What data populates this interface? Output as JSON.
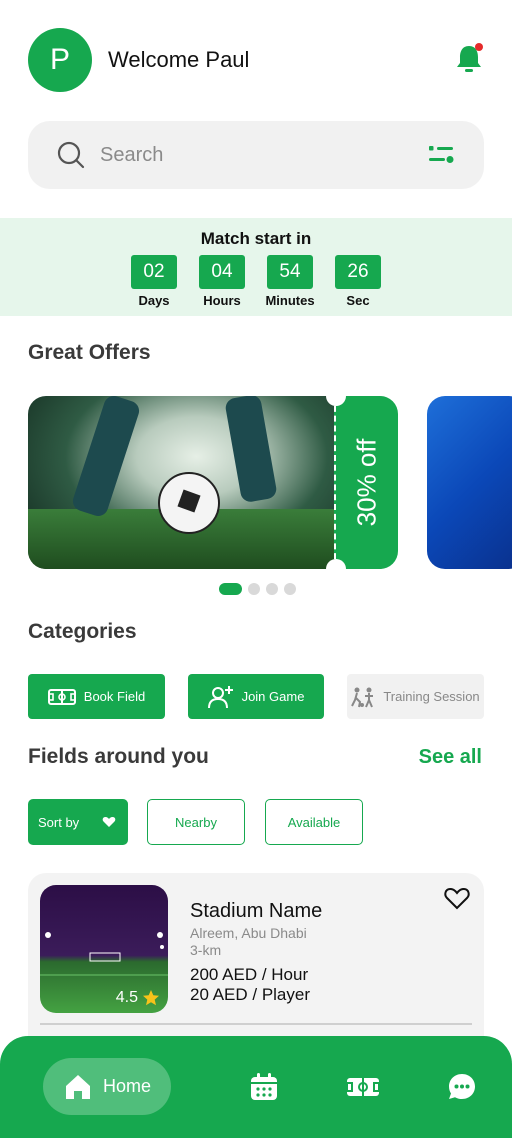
{
  "header": {
    "avatar_initial": "P",
    "welcome_text": "Welcome Paul"
  },
  "search": {
    "placeholder": "Search"
  },
  "countdown": {
    "title": "Match start in",
    "units": [
      {
        "value": "02",
        "label": "Days"
      },
      {
        "value": "04",
        "label": "Hours"
      },
      {
        "value": "54",
        "label": "Minutes"
      },
      {
        "value": "26",
        "label": "Sec"
      }
    ]
  },
  "offers": {
    "title": "Great Offers",
    "items": [
      {
        "discount": "30% off"
      }
    ],
    "active_index": 0,
    "total_pages": 4
  },
  "categories": {
    "title": "Categories",
    "items": [
      {
        "label": "Book Field",
        "icon": "field-icon",
        "active": true
      },
      {
        "label": "Join Game",
        "icon": "add-user-icon",
        "active": true
      },
      {
        "label": "Training Session",
        "icon": "training-icon",
        "active": false
      }
    ]
  },
  "fields": {
    "title": "Fields around you",
    "see_all": "See all",
    "sort_label": "Sort by",
    "filters": [
      "Nearby",
      "Available"
    ],
    "cards": [
      {
        "name": "Stadium Name",
        "location": "Alreem, Abu Dhabi",
        "distance": "3-km",
        "price_hour": "200 AED / Hour",
        "price_player": "20 AED / Player",
        "rating": "4.5"
      }
    ]
  },
  "bottom_nav": {
    "items": [
      {
        "label": "Home",
        "icon": "home-icon",
        "active": true
      },
      {
        "label": "",
        "icon": "calendar-icon",
        "active": false
      },
      {
        "label": "",
        "icon": "field-icon",
        "active": false
      },
      {
        "label": "",
        "icon": "chat-icon",
        "active": false
      }
    ]
  },
  "colors": {
    "primary": "#16a84f",
    "countdown_bg": "#e6f6eb",
    "card_bg": "#f3f3f3",
    "notification_dot": "#e52b2b"
  }
}
